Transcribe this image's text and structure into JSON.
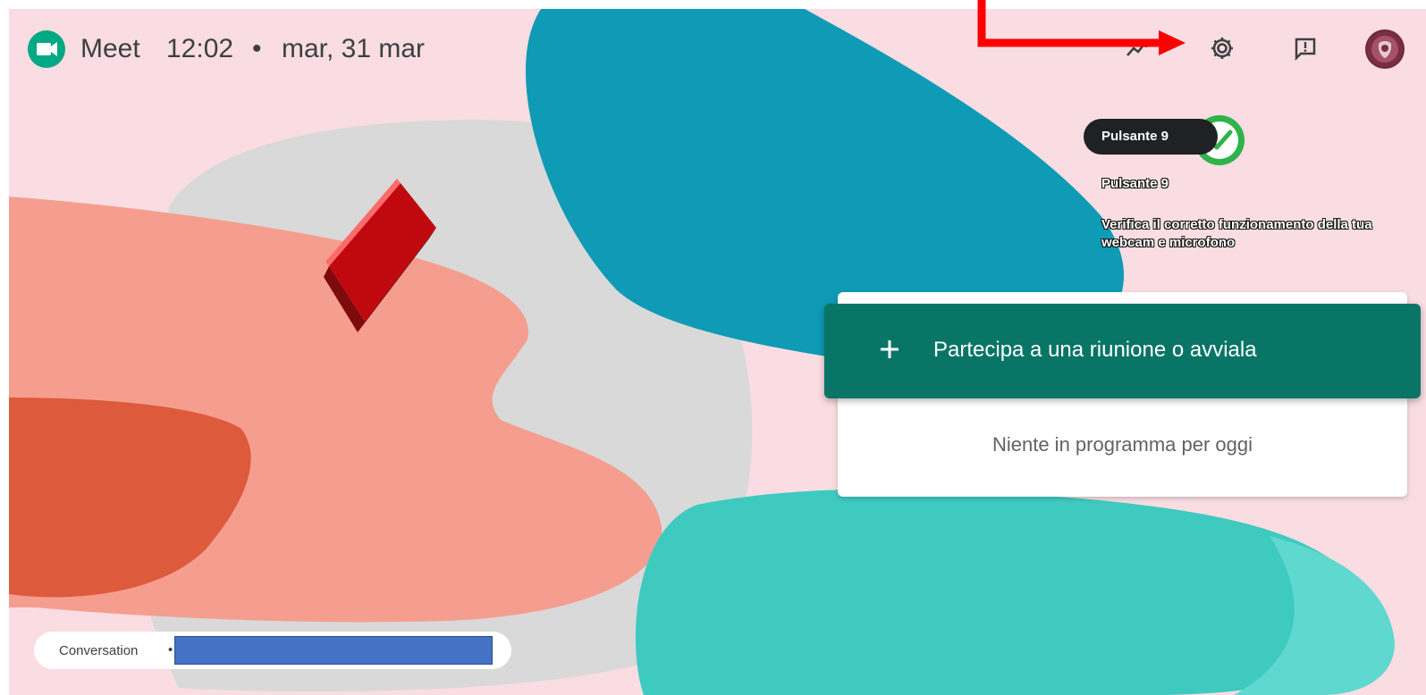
{
  "header": {
    "app_name": "Meet",
    "time": "12:02",
    "separator": "•",
    "date": "mar, 31 mar"
  },
  "icons": {
    "logo": "google-meet-icon",
    "trend": "activity-icon",
    "settings": "gear-icon",
    "feedback": "feedback-icon",
    "avatar": "account-avatar"
  },
  "tooltip": {
    "pill_label": "Pulsante 9",
    "title": "Pulsante 9",
    "description": "Verifica il corretto funzionamento della tua webcam e microfono"
  },
  "main": {
    "join_label": "Partecipa a una riunione o avviala",
    "join_icon": "plus-icon",
    "empty_message": "Niente in programma per oggi"
  },
  "conversation": {
    "label": "Conversation",
    "separator": "•"
  },
  "colors": {
    "background": "#f9dde2",
    "accent": "#087566",
    "annotation_arrow": "#ff0000",
    "annotation_check": "#2fb34a"
  }
}
